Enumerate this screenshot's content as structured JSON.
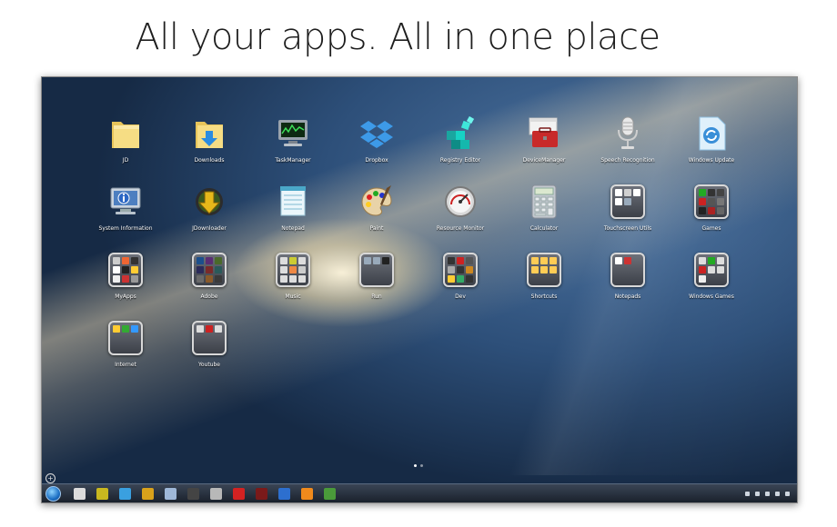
{
  "headline": "All your apps. All in one place",
  "apps": [
    {
      "label": "JD",
      "icon": "folder-icon",
      "kind": "folder"
    },
    {
      "label": "Downloads",
      "icon": "downloads-folder-icon",
      "kind": "downloads"
    },
    {
      "label": "TaskManager",
      "icon": "task-manager-icon",
      "kind": "monitor"
    },
    {
      "label": "Dropbox",
      "icon": "dropbox-icon",
      "kind": "dropbox"
    },
    {
      "label": "Registry Editor",
      "icon": "registry-editor-icon",
      "kind": "cubes"
    },
    {
      "label": "DeviceManager",
      "icon": "device-manager-icon",
      "kind": "toolbox"
    },
    {
      "label": "Speech Recognition",
      "icon": "microphone-icon",
      "kind": "mic"
    },
    {
      "label": "Windows Update",
      "icon": "windows-update-icon",
      "kind": "update"
    },
    {
      "label": "System Information",
      "icon": "system-information-icon",
      "kind": "sysinfo"
    },
    {
      "label": "JDownloader",
      "icon": "jdownloader-icon",
      "kind": "jd"
    },
    {
      "label": "Notepad",
      "icon": "notepad-icon",
      "kind": "notepad"
    },
    {
      "label": "Paint",
      "icon": "paint-palette-icon",
      "kind": "paint"
    },
    {
      "label": "Resource Monitor",
      "icon": "resource-monitor-gauge-icon",
      "kind": "gauge"
    },
    {
      "label": "Calculator",
      "icon": "calculator-icon",
      "kind": "calc"
    },
    {
      "label": "Touchscreen Utils",
      "icon": "touchscreen-utils-folder-icon",
      "kind": "group",
      "colors": [
        "#ffffff",
        "#d0d0d0",
        "#ffffff",
        "#ffffff",
        "#9ab"
      ]
    },
    {
      "label": "Games",
      "icon": "games-folder-icon",
      "kind": "group",
      "colors": [
        "#2a2",
        "#333",
        "#444",
        "#c22",
        "#555",
        "#777",
        "#222",
        "#a22",
        "#666"
      ]
    },
    {
      "label": "MyApps",
      "icon": "myapps-folder-icon",
      "kind": "group",
      "colors": [
        "#ccc",
        "#e63",
        "#333",
        "#fff",
        "#222",
        "#fc3",
        "#eee",
        "#c33",
        "#999"
      ]
    },
    {
      "label": "Adobe",
      "icon": "adobe-folder-icon",
      "kind": "group",
      "colors": [
        "#1b4f8c",
        "#5a2d73",
        "#4a6a2a",
        "#2b2b5a",
        "#7a2a2a",
        "#2a5a5a",
        "#6a6a6a",
        "#8a5a2a",
        "#3a3a3a"
      ]
    },
    {
      "label": "Music",
      "icon": "music-folder-icon",
      "kind": "group",
      "colors": [
        "#ddd",
        "#cc3",
        "#ddd",
        "#ddd",
        "#e84",
        "#ccc",
        "#ddd",
        "#ddd",
        "#ddd"
      ]
    },
    {
      "label": "Run",
      "icon": "run-folder-icon",
      "kind": "group",
      "colors": [
        "#9ab",
        "#9ab",
        "#222"
      ]
    },
    {
      "label": "Dev",
      "icon": "dev-folder-icon",
      "kind": "group",
      "colors": [
        "#333",
        "#c22",
        "#555",
        "#aaa",
        "#333",
        "#c82",
        "#fc3",
        "#3a6",
        "#333"
      ]
    },
    {
      "label": "Shortcuts",
      "icon": "shortcuts-folder-icon",
      "kind": "group",
      "colors": [
        "#fc5",
        "#fc5",
        "#fc5",
        "#fc5",
        "#fc5",
        "#fc5"
      ]
    },
    {
      "label": "Notepads",
      "icon": "notepads-folder-icon",
      "kind": "group",
      "colors": [
        "#fff",
        "#c33"
      ]
    },
    {
      "label": "Windows Games",
      "icon": "windows-games-folder-icon",
      "kind": "group",
      "colors": [
        "#ddd",
        "#2a2",
        "#ddd",
        "#c22",
        "#ddd",
        "#ddd",
        "#eee"
      ]
    },
    {
      "label": "Internet",
      "icon": "internet-folder-icon",
      "kind": "group",
      "colors": [
        "#fc3",
        "#3a3",
        "#39f"
      ]
    },
    {
      "label": "Youtube",
      "icon": "youtube-folder-icon",
      "kind": "group",
      "colors": [
        "#ddd",
        "#c22",
        "#ddd"
      ]
    }
  ],
  "taskbar": [
    {
      "icon": "photo-viewer-icon",
      "color": "#dcdcdc"
    },
    {
      "icon": "jdownloader-icon",
      "color": "#c9b81f"
    },
    {
      "icon": "windows-flag-icon",
      "color": "#3aa0e0"
    },
    {
      "icon": "diamond-app-icon",
      "color": "#d9a21b"
    },
    {
      "icon": "search-globe-icon",
      "color": "#9fb8d8"
    },
    {
      "icon": "terminal-icon",
      "color": "#444444"
    },
    {
      "icon": "person-icon",
      "color": "#b8b8b8"
    },
    {
      "icon": "youtube-icon",
      "color": "#d32222"
    },
    {
      "icon": "record-icon",
      "color": "#7a1a1a"
    },
    {
      "icon": "arrow-app-icon",
      "color": "#2d6fcf"
    },
    {
      "icon": "vlc-icon",
      "color": "#f08a1c"
    },
    {
      "icon": "chrome-icon",
      "color": "#4a9a3a"
    }
  ],
  "tray": [
    "expand-tray-icon",
    "display-icon",
    "flag-icon",
    "volume-icon",
    "network-icon"
  ]
}
